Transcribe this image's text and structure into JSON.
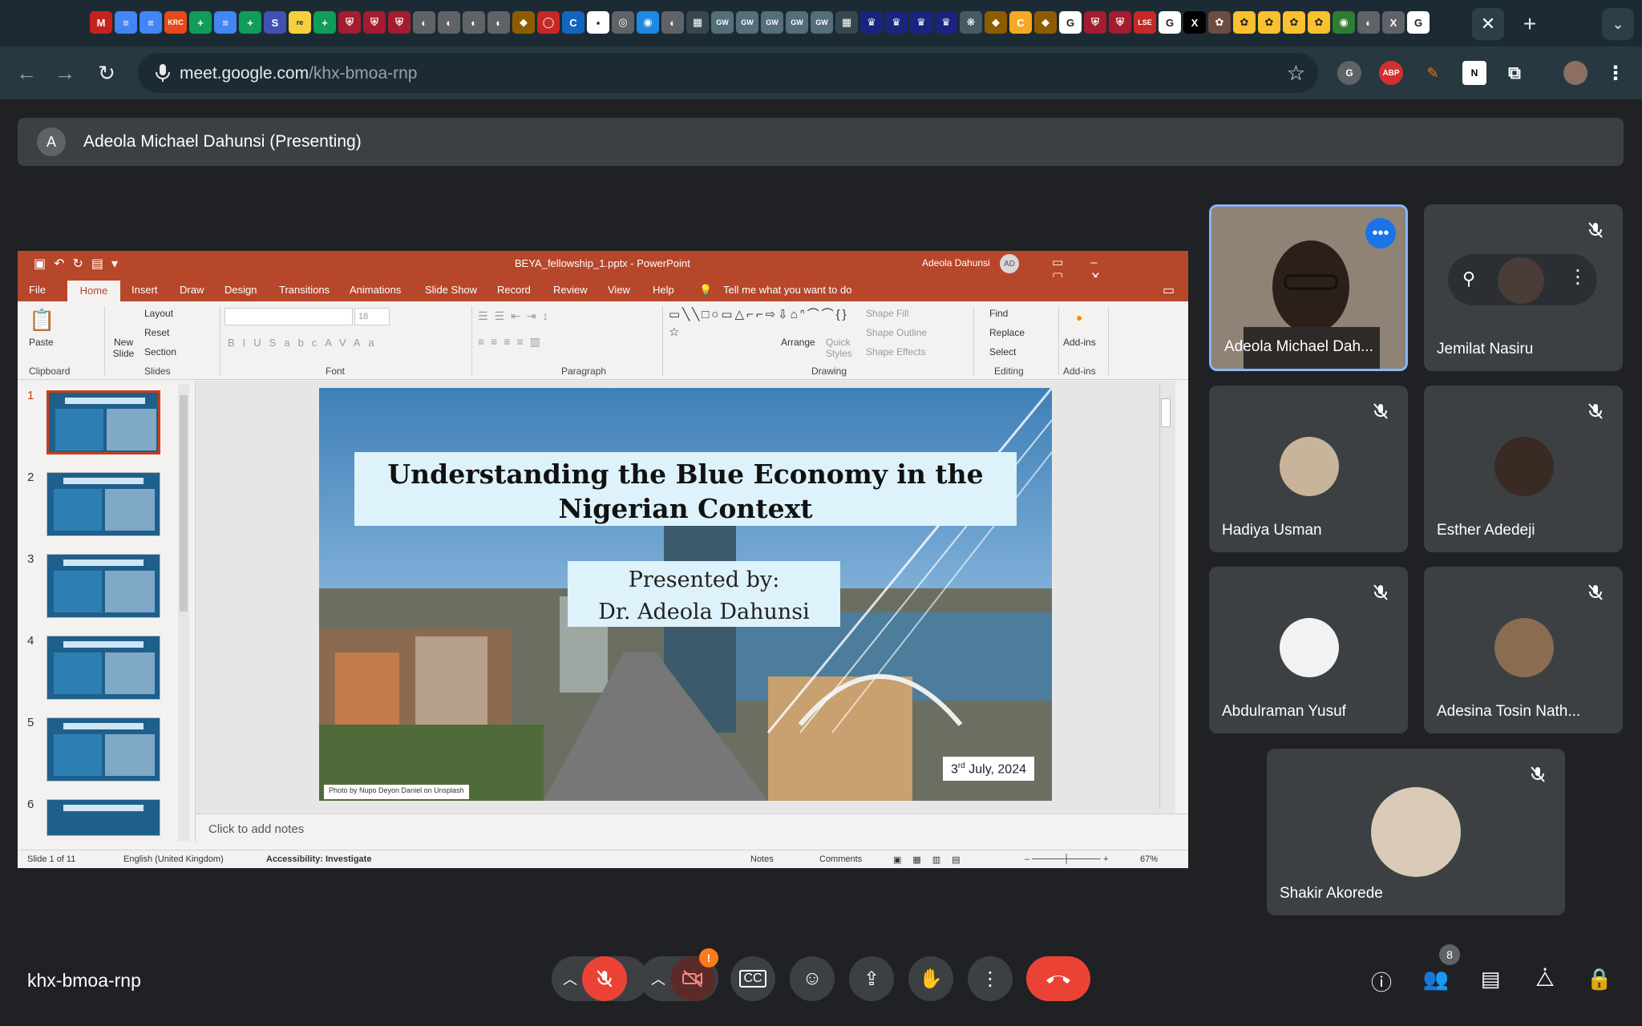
{
  "browser": {
    "active_tab_close": "✕",
    "new_tab": "+",
    "tab_dropdown": "⌄",
    "url_host": "meet.google.com",
    "url_path": "/khx-bmoa-rnp",
    "extensions": [
      "G",
      "ABP",
      "N"
    ],
    "tab_icons": [
      {
        "label": "M",
        "color": "#c5221f"
      },
      {
        "label": "≡",
        "color": "#4285f4"
      },
      {
        "label": "≡",
        "color": "#4285f4"
      },
      {
        "label": "KRC",
        "color": "#e64a19"
      },
      {
        "label": "+",
        "color": "#0f9d58"
      },
      {
        "label": "≡",
        "color": "#4285f4"
      },
      {
        "label": "+",
        "color": "#0f9d58"
      },
      {
        "label": "S",
        "color": "#3f51b5"
      },
      {
        "label": "re",
        "color": "#f4d03f"
      },
      {
        "label": "+",
        "color": "#0f9d58"
      },
      {
        "label": "⛨",
        "color": "#a51c30"
      },
      {
        "label": "⛨",
        "color": "#a51c30"
      },
      {
        "label": "⛨",
        "color": "#a51c30"
      },
      {
        "label": "◐",
        "color": "#5f6368"
      },
      {
        "label": "◐",
        "color": "#5f6368"
      },
      {
        "label": "◐",
        "color": "#5f6368"
      },
      {
        "label": "◐",
        "color": "#5f6368"
      },
      {
        "label": "◆",
        "color": "#8e5c00"
      },
      {
        "label": "◯",
        "color": "#c62828"
      },
      {
        "label": "C",
        "color": "#1565c0"
      },
      {
        "label": "▪",
        "color": "#ffffff"
      },
      {
        "label": "◎",
        "color": "#5f6368"
      },
      {
        "label": "◉",
        "color": "#1e88e5"
      },
      {
        "label": "◐",
        "color": "#5f6368"
      },
      {
        "label": "▦",
        "color": "#37474f"
      },
      {
        "label": "GW",
        "color": "#546e7a"
      },
      {
        "label": "GW",
        "color": "#546e7a"
      },
      {
        "label": "GW",
        "color": "#546e7a"
      },
      {
        "label": "GW",
        "color": "#546e7a"
      },
      {
        "label": "GW",
        "color": "#546e7a"
      },
      {
        "label": "▦",
        "color": "#37474f"
      },
      {
        "label": "♛",
        "color": "#1a237e"
      },
      {
        "label": "♛",
        "color": "#1a237e"
      },
      {
        "label": "♛",
        "color": "#1a237e"
      },
      {
        "label": "♛",
        "color": "#1a237e"
      },
      {
        "label": "❋",
        "color": "#455a64"
      },
      {
        "label": "◆",
        "color": "#8e5c00"
      },
      {
        "label": "C",
        "color": "#f9a825"
      },
      {
        "label": "◆",
        "color": "#8e5c00"
      },
      {
        "label": "G",
        "color": "#ffffff"
      },
      {
        "label": "⛨",
        "color": "#a51c30"
      },
      {
        "label": "⛨",
        "color": "#a51c30"
      },
      {
        "label": "LSE",
        "color": "#c62828"
      },
      {
        "label": "G",
        "color": "#ffffff"
      },
      {
        "label": "X",
        "color": "#000000"
      },
      {
        "label": "✿",
        "color": "#6d4c41"
      },
      {
        "label": "✿",
        "color": "#fbc02d"
      },
      {
        "label": "✿",
        "color": "#fbc02d"
      },
      {
        "label": "✿",
        "color": "#fbc02d"
      },
      {
        "label": "✿",
        "color": "#fbc02d"
      },
      {
        "label": "◉",
        "color": "#2e7d32"
      },
      {
        "label": "◐",
        "color": "#5f6368"
      },
      {
        "label": "X",
        "color": "#5f6368"
      },
      {
        "label": "G",
        "color": "#ffffff"
      }
    ]
  },
  "meet": {
    "presenter_initial": "A",
    "presenter_label": "Adeola Michael Dahunsi (Presenting)",
    "meeting_code": "khx-bmoa-rnp",
    "people_count": "8",
    "camera_alert": "!",
    "participants": [
      {
        "name": "Adeola Michael Dah...",
        "muted": false,
        "active": true
      },
      {
        "name": "Jemilat Nasiru",
        "muted": true,
        "pinned_hover": true
      },
      {
        "name": "Hadiya Usman",
        "muted": true
      },
      {
        "name": "Esther Adedeji",
        "muted": true
      },
      {
        "name": "Abdulraman Yusuf",
        "muted": true
      },
      {
        "name": "Adesina Tosin Nath...",
        "muted": true
      },
      {
        "name": "Shakir Akorede",
        "muted": true
      }
    ]
  },
  "ppt": {
    "doc_title": "BEYA_fellowship_1.pptx  -  PowerPoint",
    "user_name": "Adeola Dahunsi",
    "user_initials": "AD",
    "tabs": [
      "File",
      "Home",
      "Insert",
      "Draw",
      "Design",
      "Transitions",
      "Animations",
      "Slide Show",
      "Record",
      "Review",
      "View",
      "Help"
    ],
    "tell_me": "Tell me what you want to do",
    "ribbon": {
      "paste": "Paste",
      "clipboard": "Clipboard",
      "new_slide": "New Slide",
      "layout": "Layout",
      "reset": "Reset",
      "section": "Section",
      "slides": "Slides",
      "font": "Font",
      "font_size": "18",
      "paragraph": "Paragraph",
      "arrange": "Arrange",
      "quick_styles": "Quick Styles",
      "shape_fill": "Shape Fill",
      "shape_outline": "Shape Outline",
      "shape_effects": "Shape Effects",
      "drawing": "Drawing",
      "find": "Find",
      "replace": "Replace",
      "select": "Select",
      "editing": "Editing",
      "addins_btn": "Add-ins",
      "addins": "Add-ins"
    },
    "thumbnails": [
      "1",
      "2",
      "3",
      "4",
      "5",
      "6"
    ],
    "slide": {
      "title_line1": "Understanding the Blue Economy in the",
      "title_line2": "Nigerian Context",
      "presented_by": "Presented by:",
      "presenter": "Dr. Adeola Dahunsi",
      "date_day": "3",
      "date_sup": "rd",
      "date_rest": " July, 2024",
      "credit": "Photo by Nupo Deyon Daniel on Unsplash"
    },
    "notes_placeholder": "Click to add notes",
    "status": {
      "slide_of": "Slide 1 of 11",
      "language": "English (United Kingdom)",
      "accessibility": "Accessibility: Investigate",
      "notes": "Notes",
      "comments": "Comments",
      "zoom": "67%"
    }
  }
}
